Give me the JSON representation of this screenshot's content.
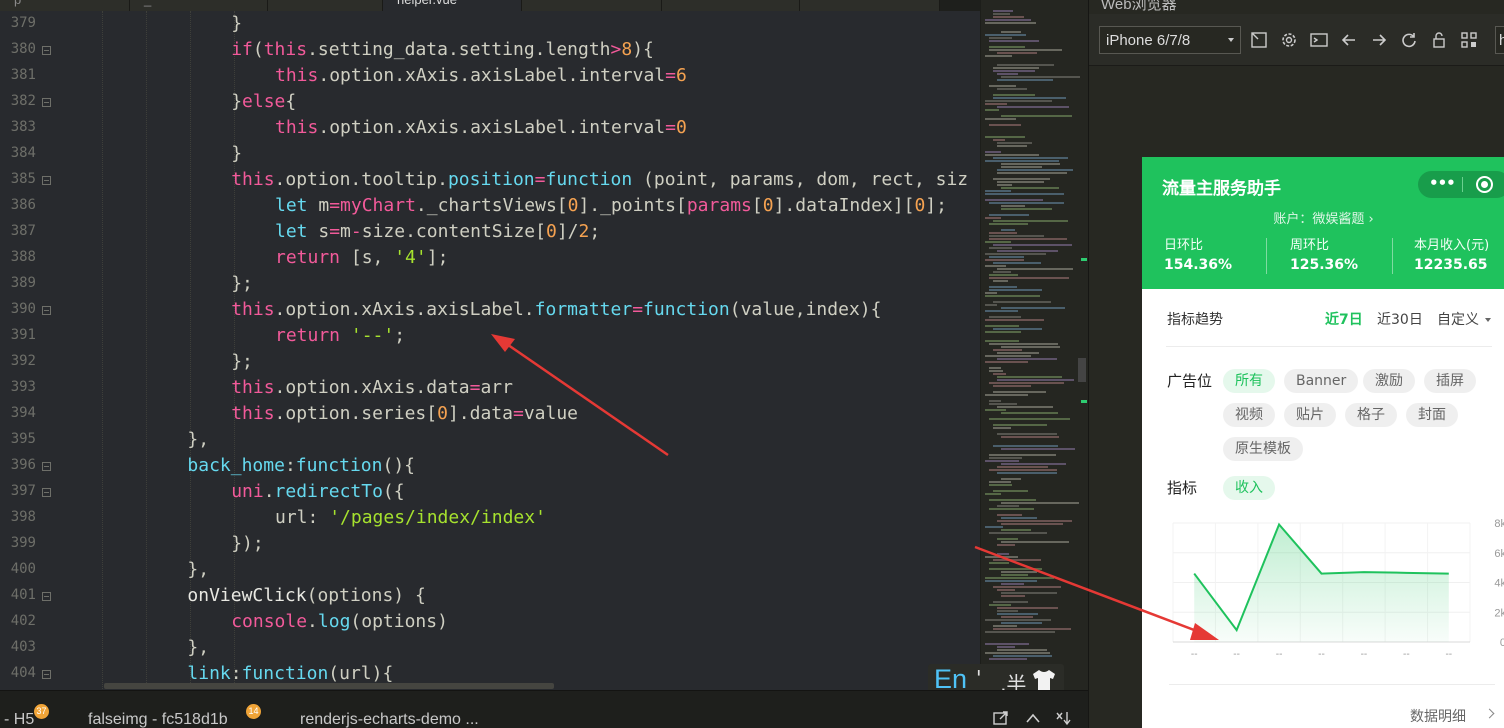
{
  "editor": {
    "tabs": [
      {
        "label": "p",
        "active": false
      },
      {
        "label": "_",
        "active": false
      },
      {
        "label": "",
        "active": false
      },
      {
        "label": "helper.vue",
        "active": true
      },
      {
        "label": "",
        "active": false
      },
      {
        "label": "",
        "active": false
      },
      {
        "label": "",
        "active": false
      }
    ],
    "lines": [
      {
        "n": "379",
        "fold": false,
        "indent": 4,
        "tokens": [
          [
            "}",
            "p"
          ]
        ]
      },
      {
        "n": "380",
        "fold": true,
        "indent": 4,
        "tokens": [
          [
            "if",
            "k"
          ],
          [
            "(",
            "p"
          ],
          [
            "this",
            "k"
          ],
          [
            ".setting_data.setting.length",
            "p"
          ],
          [
            ">",
            "k"
          ],
          [
            "8",
            "n"
          ],
          [
            "){",
            "p"
          ]
        ]
      },
      {
        "n": "381",
        "fold": false,
        "indent": 5,
        "tokens": [
          [
            "this",
            "k"
          ],
          [
            ".option.xAxis.axisLabel.interval",
            "p"
          ],
          [
            "=",
            "k"
          ],
          [
            "6",
            "n"
          ]
        ]
      },
      {
        "n": "382",
        "fold": true,
        "indent": 4,
        "tokens": [
          [
            "}",
            "p"
          ],
          [
            "else",
            "k"
          ],
          [
            "{",
            "p"
          ]
        ]
      },
      {
        "n": "383",
        "fold": false,
        "indent": 5,
        "tokens": [
          [
            "this",
            "k"
          ],
          [
            ".option.xAxis.axisLabel.interval",
            "p"
          ],
          [
            "=",
            "k"
          ],
          [
            "0",
            "n"
          ]
        ]
      },
      {
        "n": "384",
        "fold": false,
        "indent": 4,
        "tokens": [
          [
            "}",
            "p"
          ]
        ]
      },
      {
        "n": "385",
        "fold": true,
        "indent": 4,
        "tokens": [
          [
            "this",
            "k"
          ],
          [
            ".option.tooltip.",
            "p"
          ],
          [
            "position",
            "f"
          ],
          [
            "=",
            "k"
          ],
          [
            "function",
            "f"
          ],
          [
            " (point, params, dom, rect, siz",
            "p"
          ]
        ]
      },
      {
        "n": "386",
        "fold": false,
        "indent": 5,
        "tokens": [
          [
            "let",
            "f"
          ],
          [
            " m",
            "p"
          ],
          [
            "=",
            "k"
          ],
          [
            "myChart",
            "k"
          ],
          [
            "._chartsViews[",
            "p"
          ],
          [
            "0",
            "n"
          ],
          [
            "]._points[",
            "p"
          ],
          [
            "params",
            "k"
          ],
          [
            "[",
            "p"
          ],
          [
            "0",
            "n"
          ],
          [
            "].dataIndex][",
            "p"
          ],
          [
            "0",
            "n"
          ],
          [
            "];",
            "p"
          ]
        ]
      },
      {
        "n": "387",
        "fold": false,
        "indent": 5,
        "tokens": [
          [
            "let",
            "f"
          ],
          [
            " s",
            "p"
          ],
          [
            "=",
            "k"
          ],
          [
            "m",
            "p"
          ],
          [
            "-",
            "k"
          ],
          [
            "size.contentSize[",
            "p"
          ],
          [
            "0",
            "n"
          ],
          [
            "]/",
            "p"
          ],
          [
            "2",
            "n"
          ],
          [
            ";",
            "p"
          ]
        ]
      },
      {
        "n": "388",
        "fold": false,
        "indent": 5,
        "tokens": [
          [
            "return",
            "k"
          ],
          [
            " [s, ",
            "p"
          ],
          [
            "'4'",
            "s"
          ],
          [
            "];",
            "p"
          ]
        ]
      },
      {
        "n": "389",
        "fold": false,
        "indent": 4,
        "tokens": [
          [
            "};",
            "p"
          ]
        ]
      },
      {
        "n": "390",
        "fold": true,
        "indent": 4,
        "tokens": [
          [
            "this",
            "k"
          ],
          [
            ".option.xAxis.axisLabel.",
            "p"
          ],
          [
            "formatter",
            "f"
          ],
          [
            "=",
            "k"
          ],
          [
            "function",
            "f"
          ],
          [
            "(value,index){",
            "p"
          ]
        ]
      },
      {
        "n": "391",
        "fold": false,
        "indent": 5,
        "tokens": [
          [
            "return",
            "k"
          ],
          [
            " ",
            "p"
          ],
          [
            "'--'",
            "s"
          ],
          [
            ";",
            "p"
          ]
        ]
      },
      {
        "n": "392",
        "fold": false,
        "indent": 4,
        "tokens": [
          [
            "};",
            "p"
          ]
        ]
      },
      {
        "n": "393",
        "fold": false,
        "indent": 4,
        "tokens": [
          [
            "this",
            "k"
          ],
          [
            ".option.xAxis.data",
            "p"
          ],
          [
            "=",
            "k"
          ],
          [
            "arr",
            "p"
          ]
        ]
      },
      {
        "n": "394",
        "fold": false,
        "indent": 4,
        "tokens": [
          [
            "this",
            "k"
          ],
          [
            ".option.series[",
            "p"
          ],
          [
            "0",
            "n"
          ],
          [
            "].data",
            "p"
          ],
          [
            "=",
            "k"
          ],
          [
            "value",
            "p"
          ]
        ]
      },
      {
        "n": "395",
        "fold": false,
        "indent": 3,
        "tokens": [
          [
            "},",
            "p"
          ]
        ]
      },
      {
        "n": "396",
        "fold": true,
        "indent": 3,
        "tokens": [
          [
            "back_home",
            "f"
          ],
          [
            ":",
            "p"
          ],
          [
            "function",
            "f"
          ],
          [
            "(){",
            "p"
          ]
        ]
      },
      {
        "n": "397",
        "fold": true,
        "indent": 4,
        "tokens": [
          [
            "uni",
            "k"
          ],
          [
            ".",
            "p"
          ],
          [
            "redirectTo",
            "f"
          ],
          [
            "({",
            "p"
          ]
        ]
      },
      {
        "n": "398",
        "fold": false,
        "indent": 5,
        "tokens": [
          [
            "url: ",
            "p"
          ],
          [
            "'/pages/index/index'",
            "s"
          ]
        ]
      },
      {
        "n": "399",
        "fold": false,
        "indent": 4,
        "tokens": [
          [
            "});",
            "p"
          ]
        ]
      },
      {
        "n": "400",
        "fold": false,
        "indent": 3,
        "tokens": [
          [
            "},",
            "p"
          ]
        ]
      },
      {
        "n": "401",
        "fold": true,
        "indent": 3,
        "tokens": [
          [
            "onViewClick",
            "w"
          ],
          [
            "(options) {",
            "p"
          ]
        ]
      },
      {
        "n": "402",
        "fold": false,
        "indent": 4,
        "tokens": [
          [
            "console",
            "k"
          ],
          [
            ".",
            "p"
          ],
          [
            "log",
            "f"
          ],
          [
            "(options)",
            "p"
          ]
        ]
      },
      {
        "n": "403",
        "fold": false,
        "indent": 3,
        "tokens": [
          [
            "},",
            "p"
          ]
        ]
      },
      {
        "n": "404",
        "fold": true,
        "indent": 3,
        "tokens": [
          [
            "link",
            "f"
          ],
          [
            ":",
            "p"
          ],
          [
            "function",
            "f"
          ],
          [
            "(url){",
            "p"
          ]
        ]
      }
    ]
  },
  "ime": {
    "lang": "En",
    "punct": "'",
    "width": ",半"
  },
  "status_tabs": [
    {
      "label": "- H5",
      "badge": "37"
    },
    {
      "label": "falseimg - fc518d1b",
      "badge": "14"
    },
    {
      "label": "renderjs-echarts-demo ...",
      "badge": ""
    }
  ],
  "browser": {
    "title": "Web浏览器",
    "device": "iPhone 6/7/8",
    "url": "h"
  },
  "app": {
    "title": "流量主服务助手",
    "account": "账户：微娱酱题 ›",
    "stats": [
      {
        "label": "日环比",
        "value": "154.36%"
      },
      {
        "label": "周环比",
        "value": "125.36%"
      },
      {
        "label": "本月收入(元)",
        "value": "12235.65"
      }
    ],
    "trend_label": "指标趋势",
    "ranges": [
      {
        "label": "近7日",
        "active": true
      },
      {
        "label": "近30日",
        "active": false
      },
      {
        "label": "自定义",
        "active": false
      }
    ],
    "ad_label": "广告位",
    "ad_chips": [
      {
        "label": "所有",
        "active": true
      },
      {
        "label": "Banner",
        "active": false
      },
      {
        "label": "激励",
        "active": false
      },
      {
        "label": "插屏",
        "active": false
      },
      {
        "label": "视频",
        "active": false
      },
      {
        "label": "贴片",
        "active": false
      },
      {
        "label": "格子",
        "active": false
      },
      {
        "label": "封面",
        "active": false
      },
      {
        "label": "原生模板",
        "active": false
      }
    ],
    "metric_label": "指标",
    "metric_chips": [
      {
        "label": "收入",
        "active": true
      }
    ],
    "detail_link": "数据明细"
  },
  "chart_data": {
    "type": "area",
    "x": [
      "--",
      "--",
      "--",
      "--",
      "--",
      "--",
      "--"
    ],
    "y": [
      4600,
      800,
      7900,
      4600,
      4700,
      4650,
      4600
    ],
    "ylim": [
      0,
      8000
    ],
    "yticks": [
      "0",
      "2k",
      "4k",
      "6k",
      "8k"
    ],
    "color": "#1fc25d",
    "grid": true
  },
  "colors": {
    "accent": "#1fc25d",
    "annotation": "#e53935"
  }
}
